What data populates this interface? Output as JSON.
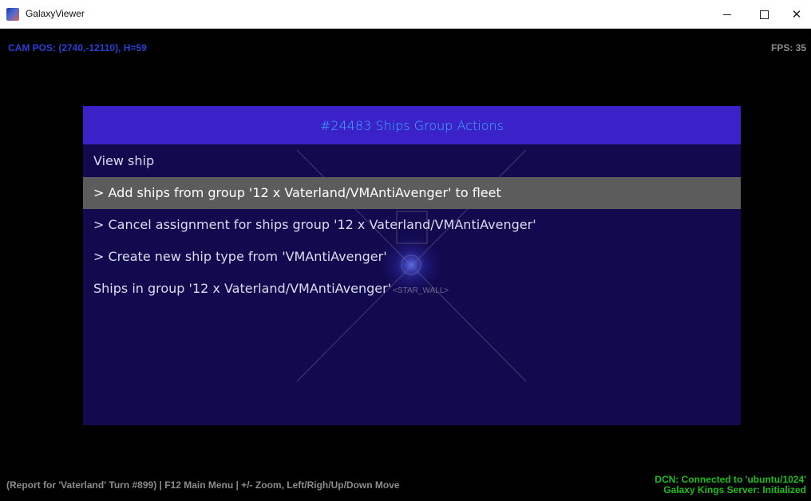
{
  "window": {
    "title": "GalaxyViewer",
    "minimize_glyph": "",
    "maximize_glyph": "",
    "close_glyph": "✕"
  },
  "hud": {
    "cam_pos": "CAM POS: (2740,-12110), H=59",
    "fps": "FPS: 35"
  },
  "dialog": {
    "title": "#24483 Ships Group Actions",
    "items": [
      {
        "label": "View ship",
        "selected": false
      },
      {
        "label": "> Add ships from group '12 x Vaterland/VMAntiAvenger' to fleet",
        "selected": true
      },
      {
        "label": "> Cancel assignment for ships group '12 x Vaterland/VMAntiAvenger'",
        "selected": false
      },
      {
        "label": "> Create new ship type from 'VMAntiAvenger'",
        "selected": false
      },
      {
        "label": "Ships in group '12 x Vaterland/VMAntiAvenger'",
        "selected": false
      }
    ],
    "star_label": "<STAR_WALL>"
  },
  "status": {
    "left": "(Report for 'Vaterland' Turn #899) | F12 Main Menu | +/- Zoom, Left/Righ/Up/Down Move",
    "dcn": "DCN: Connected to 'ubuntu/1024'",
    "server": "Galaxy Kings Server: Initialized"
  },
  "colors": {
    "cam_pos": "#2a3fd6",
    "dialog_header": "#3a22c8",
    "dialog_title": "#3cb0ff",
    "dialog_body": "#120a4f",
    "selected_row": "#5c5c5c",
    "status_ok": "#1bbf1b",
    "hud_gray": "#8c8c8c"
  }
}
